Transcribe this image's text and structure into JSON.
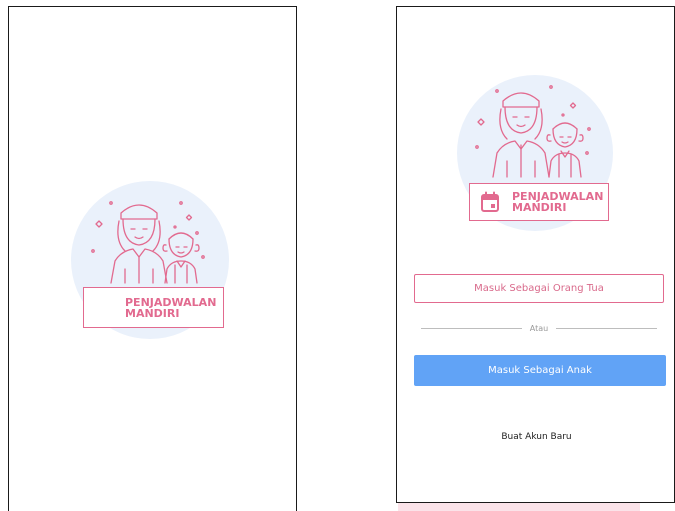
{
  "splash_screen": {
    "logo": {
      "line1": "PENJADWALAN",
      "line2": "MANDIRI",
      "icon": "parent-child-illustration"
    }
  },
  "login_screen": {
    "logo": {
      "line1": "PENJADWALAN",
      "line2": "MANDIRI",
      "icon": "calendar-icon"
    },
    "parent_login_label": "Masuk Sebagai Orang Tua",
    "divider_label": "Atau",
    "child_login_label": "Masuk Sebagai Anak",
    "create_account_label": "Buat Akun Baru"
  },
  "colors": {
    "accent_pink": "#e26a8f",
    "primary_blue": "#61a3f6",
    "logo_circle": "#eaf1fb"
  }
}
